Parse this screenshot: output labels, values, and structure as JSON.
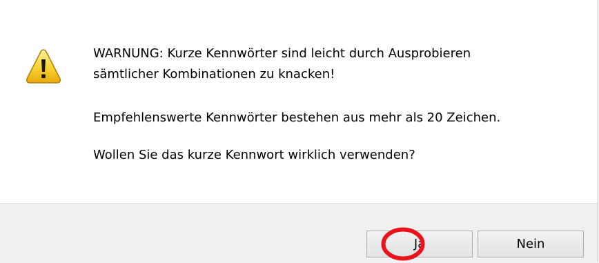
{
  "dialog": {
    "icon": "warning-triangle-icon",
    "message": {
      "line1": "WARNUNG: Kurze Kennwörter sind leicht durch Ausprobieren",
      "line2": "sämtlicher Kombinationen zu knacken!",
      "line3": "Empfehlenswerte Kennwörter bestehen aus mehr als 20 Zeichen.",
      "line4": "Wollen Sie das kurze Kennwort wirklich verwenden?"
    },
    "buttons": {
      "yes_label": "Ja",
      "no_label": "Nein"
    }
  },
  "annotation": {
    "highlight": "red-circle-around-yes-button",
    "color": "#e8131b"
  }
}
